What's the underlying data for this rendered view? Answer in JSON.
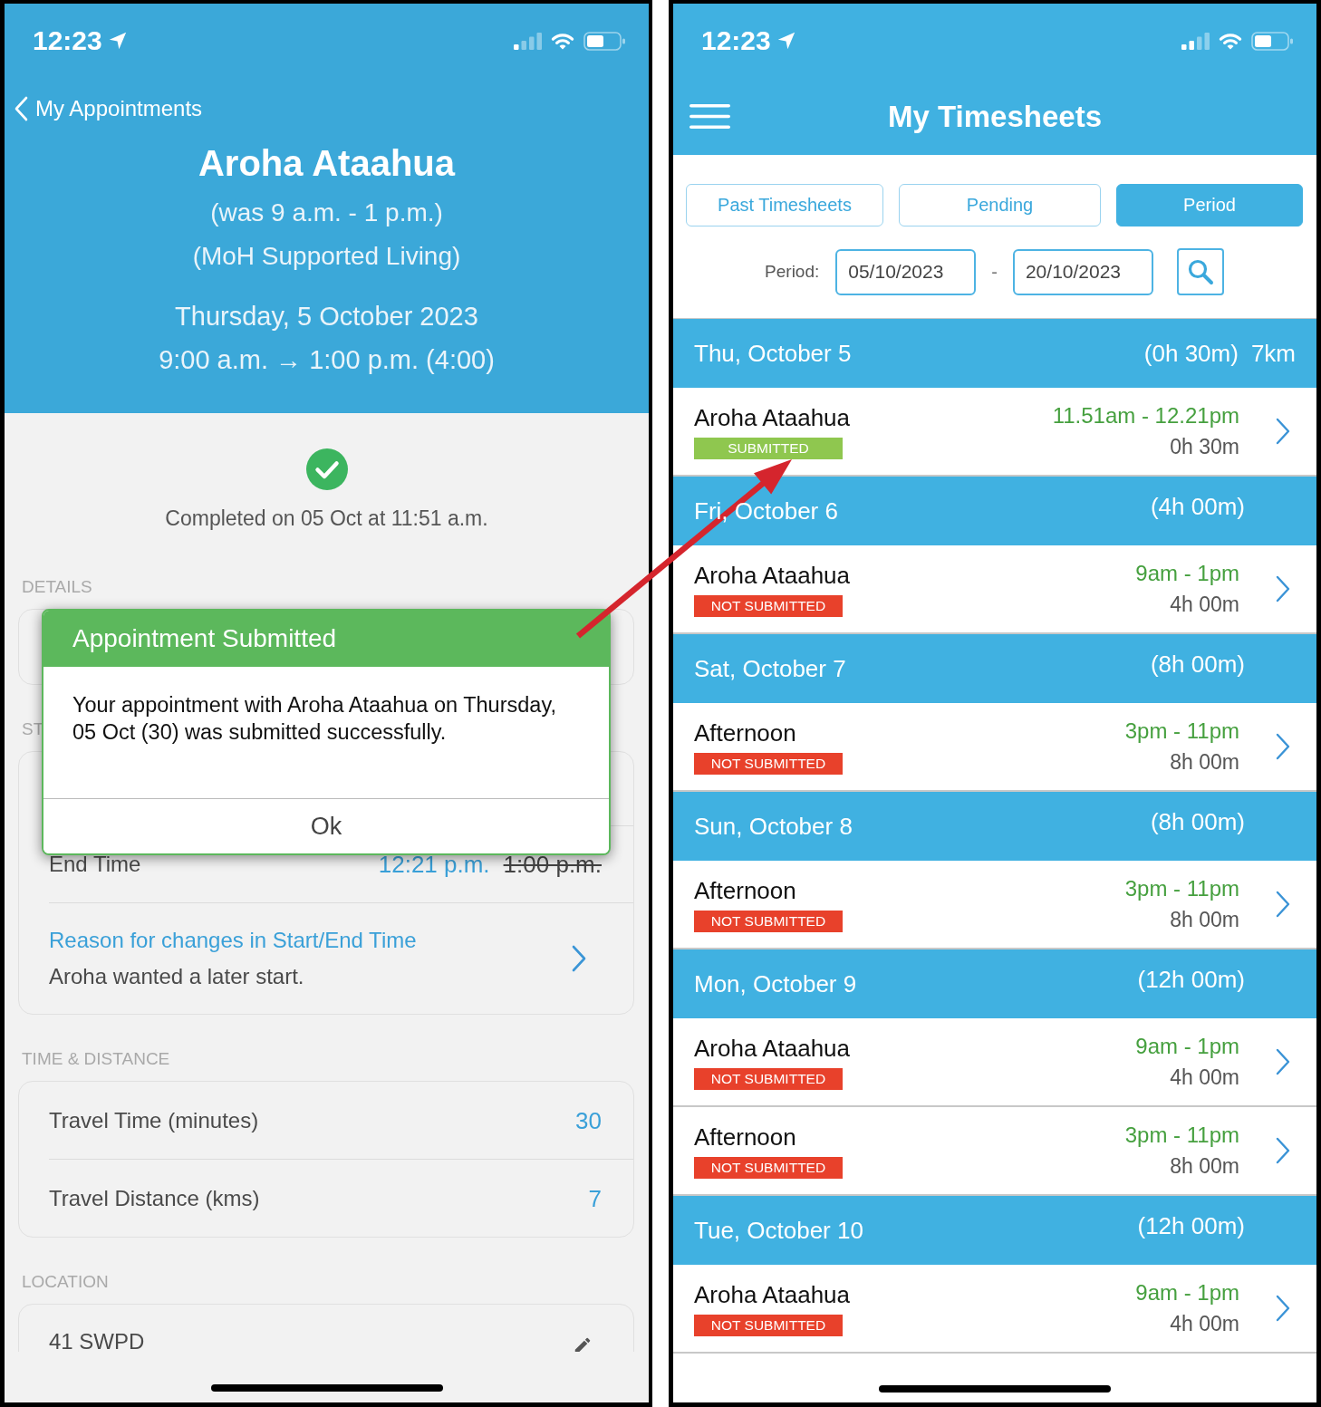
{
  "left_screen": {
    "status_bar": {
      "time": "12:23"
    },
    "back_label": "My Appointments",
    "header": {
      "title": "Aroha Ataahua",
      "subtitles": [
        "(was 9 a.m. - 1 p.m.)",
        "(MoH Supported Living)"
      ],
      "date": "Thursday, 5 October 2023",
      "time_range": "9:00 a.m. → 1:00 p.m. (4:00)"
    },
    "completion": {
      "text": "Completed on 05 Oct at 11:51 a.m."
    },
    "sections": [
      {
        "label": "DETAILS"
      },
      {
        "label": "ST",
        "rows": [
          {
            "kind": "time_change",
            "label": "End Time",
            "new_value": "12:21 p.m.",
            "old_value": "1:00 p.m."
          },
          {
            "kind": "link",
            "title": "Reason for changes in Start/End Time",
            "detail": "Aroha wanted a later start."
          }
        ]
      },
      {
        "label": "TIME & DISTANCE",
        "rows": [
          {
            "kind": "value",
            "label": "Travel Time (minutes)",
            "value": "30"
          },
          {
            "kind": "value",
            "label": "Travel Distance (kms)",
            "value": "7"
          }
        ]
      },
      {
        "label": "LOCATION",
        "rows": [
          {
            "kind": "location",
            "label": "41 SWPD"
          }
        ]
      }
    ],
    "dialog": {
      "title": "Appointment Submitted",
      "message": "Your appointment with Aroha Ataahua on Thursday, 05 Oct (30) was submitted successfully.",
      "button": "Ok"
    }
  },
  "right_screen": {
    "status_bar": {
      "time": "12:23"
    },
    "title": "My Timesheets",
    "tabs": [
      {
        "label": "Past Timesheets",
        "selected": false
      },
      {
        "label": "Pending",
        "selected": false
      },
      {
        "label": "Period",
        "selected": true
      }
    ],
    "period": {
      "label": "Period:",
      "from": "05/10/2023",
      "separator": "-",
      "to": "20/10/2023"
    },
    "days": [
      {
        "label": "Thu, October 5",
        "total": "(0h 30m)",
        "distance": "7km",
        "entries": [
          {
            "name": "Aroha Ataahua",
            "status": "SUBMITTED",
            "submitted": true,
            "time_range": "11.51am - 12.21pm",
            "duration": "0h 30m"
          }
        ]
      },
      {
        "label": "Fri, October 6",
        "total": "(4h 00m)",
        "entries": [
          {
            "name": "Aroha Ataahua",
            "status": "NOT SUBMITTED",
            "submitted": false,
            "time_range": "9am - 1pm",
            "duration": "4h 00m"
          }
        ]
      },
      {
        "label": "Sat, October 7",
        "total": "(8h 00m)",
        "entries": [
          {
            "name": "Afternoon",
            "status": "NOT SUBMITTED",
            "submitted": false,
            "time_range": "3pm - 11pm",
            "duration": "8h 00m"
          }
        ]
      },
      {
        "label": "Sun, October 8",
        "total": "(8h 00m)",
        "entries": [
          {
            "name": "Afternoon",
            "status": "NOT SUBMITTED",
            "submitted": false,
            "time_range": "3pm - 11pm",
            "duration": "8h 00m"
          }
        ]
      },
      {
        "label": "Mon, October 9",
        "total": "(12h 00m)",
        "entries": [
          {
            "name": "Aroha Ataahua",
            "status": "NOT SUBMITTED",
            "submitted": false,
            "time_range": "9am - 1pm",
            "duration": "4h 00m"
          },
          {
            "name": "Afternoon",
            "status": "NOT SUBMITTED",
            "submitted": false,
            "time_range": "3pm - 11pm",
            "duration": "8h 00m"
          }
        ]
      },
      {
        "label": "Tue, October 10",
        "total": "(12h 00m)",
        "entries": [
          {
            "name": "Aroha Ataahua",
            "status": "NOT SUBMITTED",
            "submitted": false,
            "time_range": "9am - 1pm",
            "duration": "4h 00m"
          }
        ]
      }
    ]
  },
  "annotations": [
    {
      "kind": "arrow"
    }
  ]
}
